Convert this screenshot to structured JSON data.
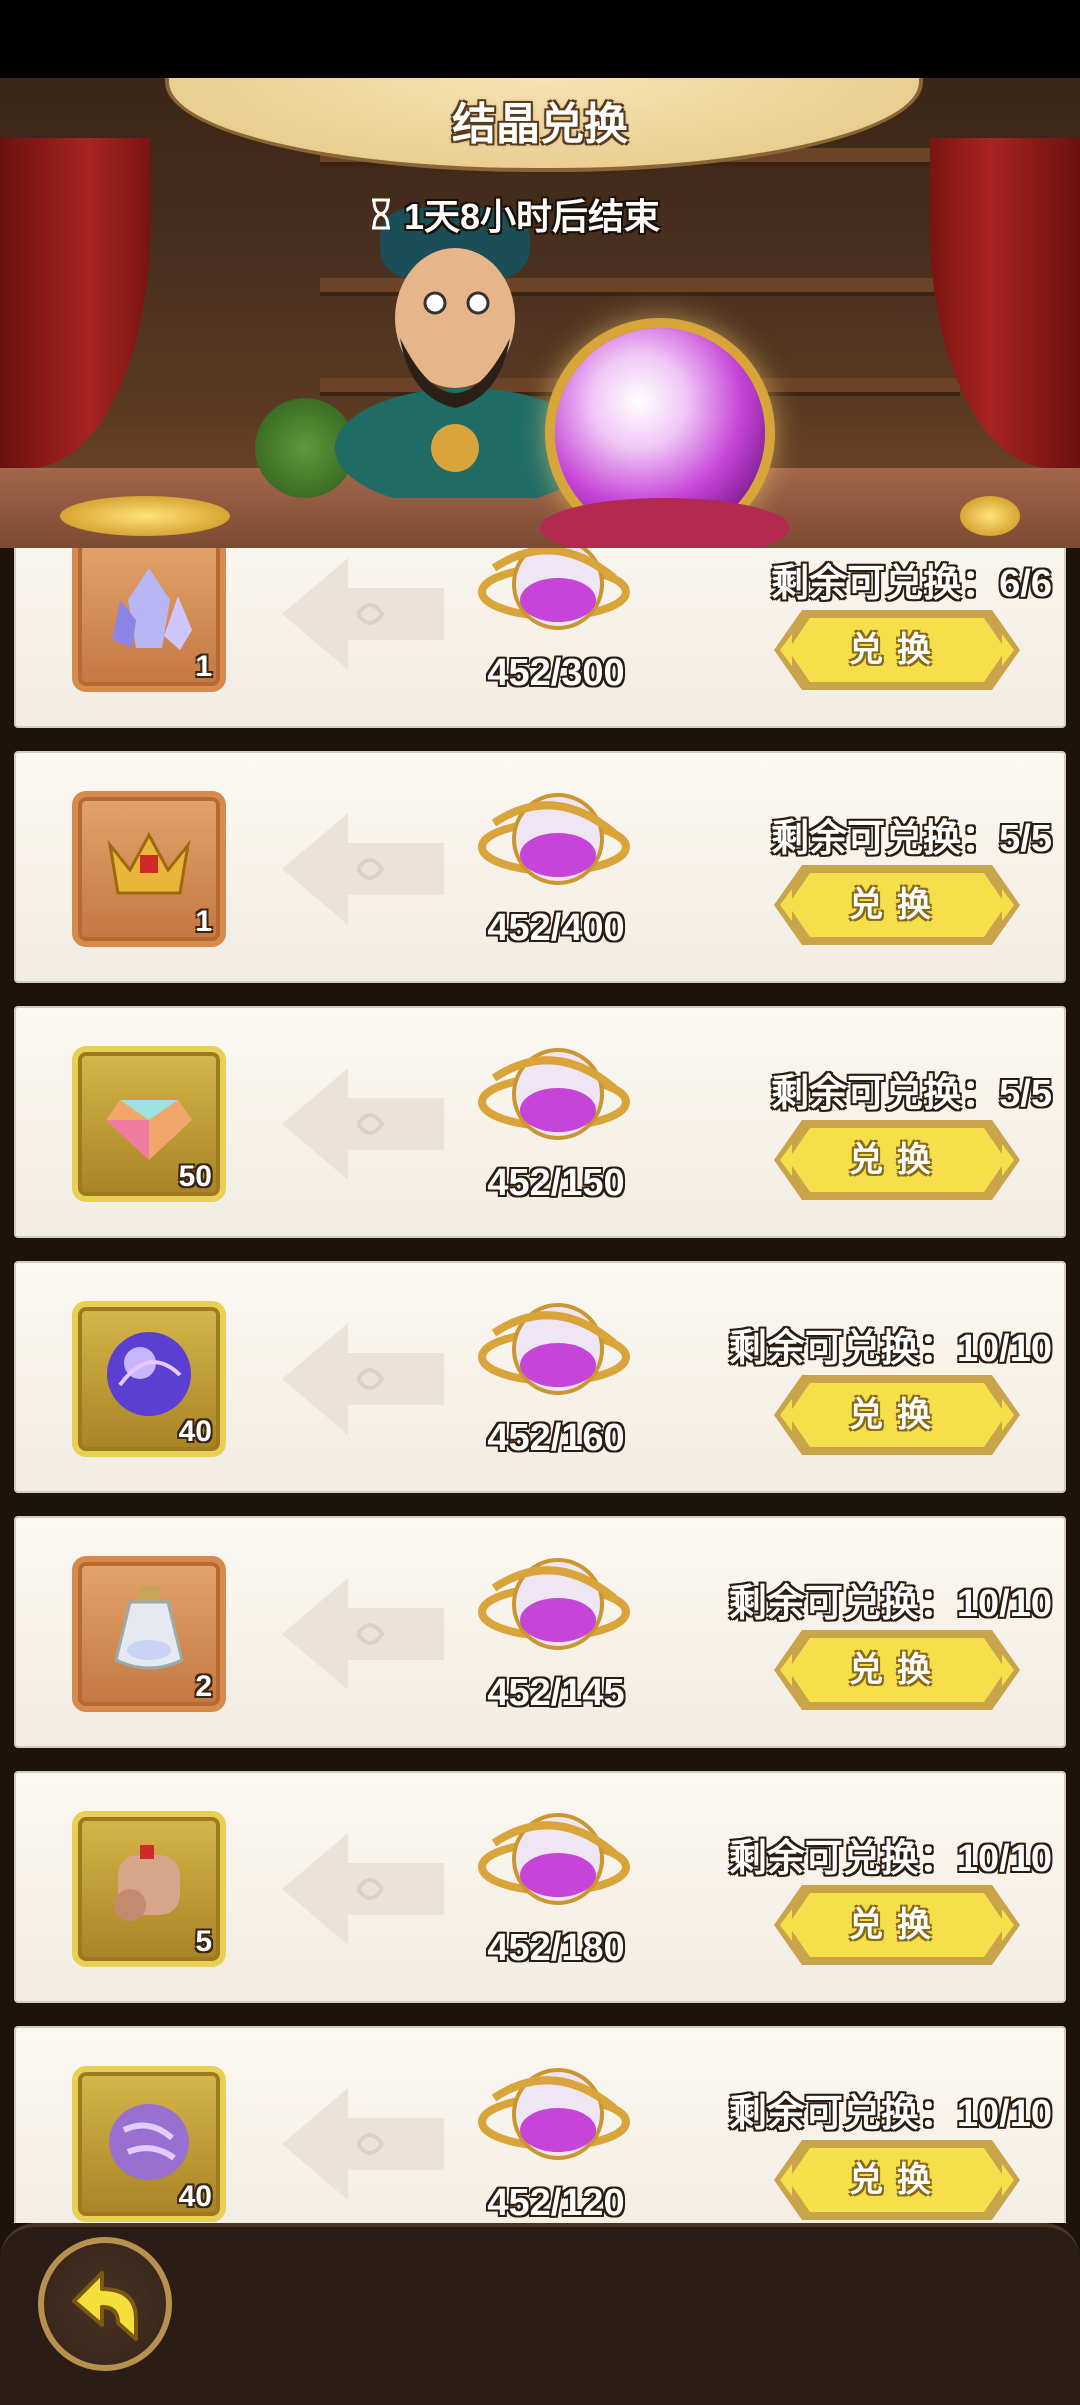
{
  "header": {
    "title": "结晶兑换",
    "timer": "1天8小时后结束"
  },
  "exchange": {
    "remaining_prefix": "剩余可兑换：",
    "button_label": "兑换",
    "rows": [
      {
        "item": "crystal-cluster-icon",
        "frame": "orange",
        "quantity": "1",
        "cost": "452/300",
        "remaining": "6/6"
      },
      {
        "item": "golden-headpiece-icon",
        "frame": "orange",
        "quantity": "1",
        "cost": "452/400",
        "remaining": "5/5"
      },
      {
        "item": "rainbow-diamond-icon",
        "frame": "gold",
        "quantity": "50",
        "cost": "452/150",
        "remaining": "5/5"
      },
      {
        "item": "energy-orb-icon",
        "frame": "gold",
        "quantity": "40",
        "cost": "452/160",
        "remaining": "10/10"
      },
      {
        "item": "potion-bottle-icon",
        "frame": "orange",
        "quantity": "2",
        "cost": "452/145",
        "remaining": "10/10"
      },
      {
        "item": "scroll-icon",
        "frame": "gold",
        "quantity": "5",
        "cost": "452/180",
        "remaining": "10/10"
      },
      {
        "item": "purple-stone-icon",
        "frame": "gold",
        "quantity": "40",
        "cost": "452/120",
        "remaining": "10/10"
      }
    ]
  },
  "colors": {
    "button_yellow": "#f5e04c",
    "button_rim": "#c9a44a",
    "panel_bg": "#f7f3ec",
    "footer_bg": "#2a1d15",
    "orb_purple": "#c645d8"
  }
}
